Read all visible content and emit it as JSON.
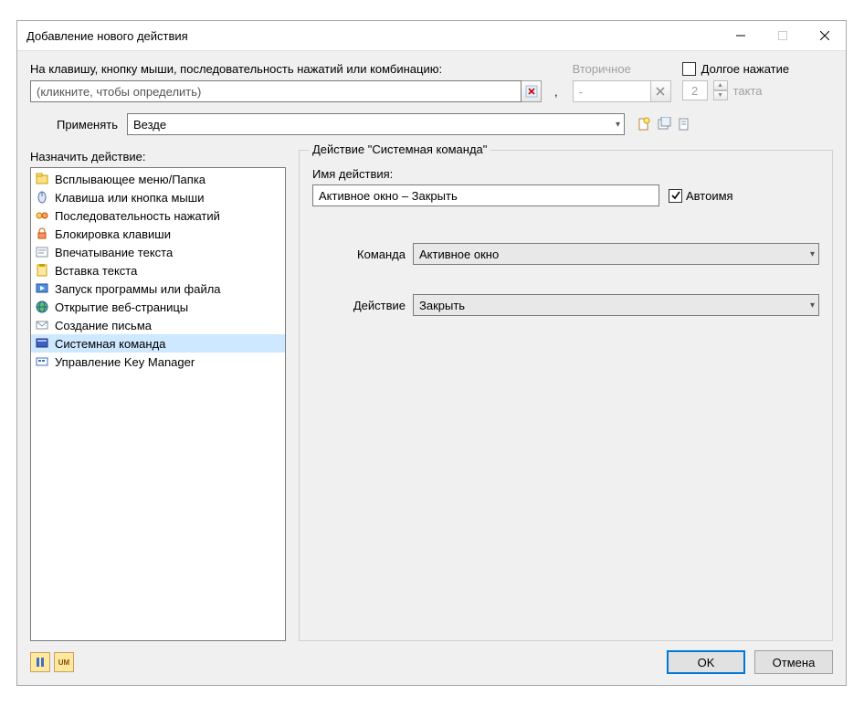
{
  "window": {
    "title": "Добавление нового действия"
  },
  "top": {
    "key_label": "На клавишу, кнопку мыши, последовательность нажатий или комбинацию:",
    "key_placeholder": "(кликните, чтобы определить)",
    "secondary_label": "Вторичное",
    "secondary_value": "-",
    "longpress_label": "Долгое нажатие",
    "delay_value": "2",
    "delay_unit": "такта",
    "apply_label": "Применять",
    "apply_value": "Везде"
  },
  "left": {
    "label": "Назначить действие:"
  },
  "actions_list": [
    {
      "label": "Всплывающее меню/Папка",
      "icon": "folder"
    },
    {
      "label": "Клавиша или кнопка мыши",
      "icon": "mouse"
    },
    {
      "label": "Последовательность нажатий",
      "icon": "sequence"
    },
    {
      "label": "Блокировка клавиши",
      "icon": "lock"
    },
    {
      "label": "Впечатывание текста",
      "icon": "type"
    },
    {
      "label": "Вставка текста",
      "icon": "paste"
    },
    {
      "label": "Запуск программы или файла",
      "icon": "run"
    },
    {
      "label": "Открытие веб-страницы",
      "icon": "web"
    },
    {
      "label": "Создание письма",
      "icon": "mail"
    },
    {
      "label": "Системная команда",
      "icon": "syscmd",
      "selected": true
    },
    {
      "label": "Управление Key Manager",
      "icon": "kmgr"
    }
  ],
  "right": {
    "group_title": "Действие \"Системная команда\"",
    "name_label": "Имя действия:",
    "name_value": "Активное окно – Закрыть",
    "autoname_label": "Автоимя",
    "autoname_checked": true,
    "command_label": "Команда",
    "command_value": "Активное окно",
    "action_label": "Действие",
    "action_value": "Закрыть"
  },
  "buttons": {
    "ok": "OK",
    "cancel": "Отмена"
  }
}
